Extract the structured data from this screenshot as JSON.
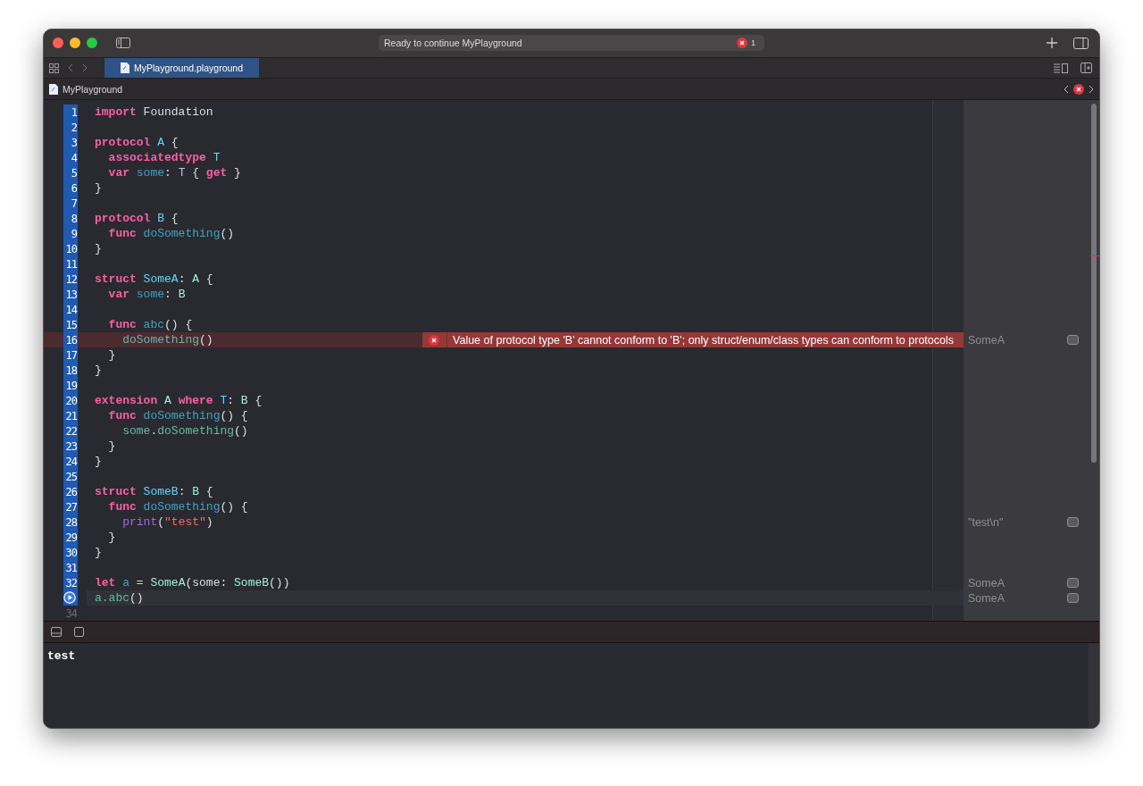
{
  "window": {
    "status": "Ready to continue MyPlayground",
    "error_count": "1"
  },
  "tabs": [
    {
      "label": "MyPlayground.playground",
      "selected": true
    }
  ],
  "jump_bar": {
    "label": "MyPlayground"
  },
  "editor": {
    "lines": [
      {
        "kind": "code",
        "number": "1",
        "executed": true,
        "tokens": [
          {
            "text": "import",
            "kind": "keyword"
          },
          {
            "text": " Foundation",
            "kind": "plain"
          }
        ]
      },
      {
        "kind": "code",
        "number": "2",
        "executed": true
      },
      {
        "kind": "code",
        "number": "3",
        "executed": true,
        "tokens": [
          {
            "text": "protocol",
            "kind": "keyword"
          },
          {
            "text": " A",
            "kind": "decl-type"
          },
          {
            "text": " {",
            "kind": "plain"
          }
        ]
      },
      {
        "kind": "code",
        "number": "4",
        "executed": true,
        "tokens": [
          {
            "text": "  associatedtype",
            "kind": "keyword"
          },
          {
            "text": " T",
            "kind": "decl-type"
          }
        ]
      },
      {
        "kind": "code",
        "number": "5",
        "executed": true,
        "tokens": [
          {
            "text": "  var",
            "kind": "keyword"
          },
          {
            "text": " some",
            "kind": "decl"
          },
          {
            "text": ": ",
            "kind": "plain"
          },
          {
            "text": "T",
            "kind": "generic"
          },
          {
            "text": " { ",
            "kind": "plain"
          },
          {
            "text": "get",
            "kind": "keyword"
          },
          {
            "text": " }",
            "kind": "plain"
          }
        ]
      },
      {
        "kind": "code",
        "number": "6",
        "executed": true,
        "tokens": [
          {
            "text": "}",
            "kind": "plain"
          }
        ]
      },
      {
        "kind": "code",
        "number": "7",
        "executed": true
      },
      {
        "kind": "code",
        "number": "8",
        "executed": true,
        "tokens": [
          {
            "text": "protocol",
            "kind": "keyword"
          },
          {
            "text": " B",
            "kind": "decl-type"
          },
          {
            "text": " {",
            "kind": "plain"
          }
        ]
      },
      {
        "kind": "code",
        "number": "9",
        "executed": true,
        "tokens": [
          {
            "text": "  func",
            "kind": "keyword"
          },
          {
            "text": " doSomething",
            "kind": "decl"
          },
          {
            "text": "()",
            "kind": "plain"
          }
        ]
      },
      {
        "kind": "code",
        "number": "10",
        "executed": true,
        "tokens": [
          {
            "text": "}",
            "kind": "plain"
          }
        ]
      },
      {
        "kind": "code",
        "number": "11",
        "executed": true
      },
      {
        "kind": "code",
        "number": "12",
        "executed": true,
        "tokens": [
          {
            "text": "struct",
            "kind": "keyword"
          },
          {
            "text": " SomeA",
            "kind": "decl-type"
          },
          {
            "text": ": ",
            "kind": "plain"
          },
          {
            "text": "A",
            "kind": "type"
          },
          {
            "text": " {",
            "kind": "plain"
          }
        ]
      },
      {
        "kind": "code",
        "number": "13",
        "executed": true,
        "tokens": [
          {
            "text": "  var",
            "kind": "keyword"
          },
          {
            "text": " some",
            "kind": "decl"
          },
          {
            "text": ": ",
            "kind": "plain"
          },
          {
            "text": "B",
            "kind": "type"
          }
        ]
      },
      {
        "kind": "code",
        "number": "14",
        "executed": true
      },
      {
        "kind": "code",
        "number": "15",
        "executed": true,
        "tokens": [
          {
            "text": "  func",
            "kind": "keyword"
          },
          {
            "text": " abc",
            "kind": "decl"
          },
          {
            "text": "() {",
            "kind": "plain"
          }
        ]
      },
      {
        "kind": "code",
        "number": "16",
        "executed": true,
        "tokens": [
          {
            "text": "    doSomething",
            "kind": "call"
          },
          {
            "text": "()",
            "kind": "plain"
          }
        ],
        "error": "Value of protocol type 'B' cannot conform to 'B'; only struct/enum/class types can conform to protocols",
        "result": "SomeA"
      },
      {
        "kind": "code",
        "number": "17",
        "executed": true,
        "tokens": [
          {
            "text": "  }",
            "kind": "plain"
          }
        ]
      },
      {
        "kind": "code",
        "number": "18",
        "executed": true,
        "tokens": [
          {
            "text": "}",
            "kind": "plain"
          }
        ]
      },
      {
        "kind": "code",
        "number": "19",
        "executed": true
      },
      {
        "kind": "code",
        "number": "20",
        "executed": true,
        "tokens": [
          {
            "text": "extension",
            "kind": "keyword"
          },
          {
            "text": " A",
            "kind": "type"
          },
          {
            "text": " where",
            "kind": "keyword"
          },
          {
            "text": " T",
            "kind": "decl-type"
          },
          {
            "text": ": ",
            "kind": "plain"
          },
          {
            "text": "B",
            "kind": "type"
          },
          {
            "text": " {",
            "kind": "plain"
          }
        ]
      },
      {
        "kind": "code",
        "number": "21",
        "executed": true,
        "tokens": [
          {
            "text": "  func",
            "kind": "keyword"
          },
          {
            "text": " doSomething",
            "kind": "decl"
          },
          {
            "text": "() {",
            "kind": "plain"
          }
        ]
      },
      {
        "kind": "code",
        "number": "22",
        "executed": true,
        "tokens": [
          {
            "text": "    some",
            "kind": "call"
          },
          {
            "text": ".",
            "kind": "plain"
          },
          {
            "text": "doSomething",
            "kind": "call"
          },
          {
            "text": "()",
            "kind": "plain"
          }
        ]
      },
      {
        "kind": "code",
        "number": "23",
        "executed": true,
        "tokens": [
          {
            "text": "  }",
            "kind": "plain"
          }
        ]
      },
      {
        "kind": "code",
        "number": "24",
        "executed": true,
        "tokens": [
          {
            "text": "}",
            "kind": "plain"
          }
        ]
      },
      {
        "kind": "code",
        "number": "25",
        "executed": true
      },
      {
        "kind": "code",
        "number": "26",
        "executed": true,
        "tokens": [
          {
            "text": "struct",
            "kind": "keyword"
          },
          {
            "text": " SomeB",
            "kind": "decl-type"
          },
          {
            "text": ": ",
            "kind": "plain"
          },
          {
            "text": "B",
            "kind": "type"
          },
          {
            "text": " {",
            "kind": "plain"
          }
        ]
      },
      {
        "kind": "code",
        "number": "27",
        "executed": true,
        "tokens": [
          {
            "text": "  func",
            "kind": "keyword"
          },
          {
            "text": " doSomething",
            "kind": "decl"
          },
          {
            "text": "() {",
            "kind": "plain"
          }
        ]
      },
      {
        "kind": "code",
        "number": "28",
        "executed": true,
        "tokens": [
          {
            "text": "    print",
            "kind": "builtin"
          },
          {
            "text": "(",
            "kind": "plain"
          },
          {
            "text": "\"test\"",
            "kind": "string"
          },
          {
            "text": ")",
            "kind": "plain"
          }
        ],
        "result": "\"test\\n\""
      },
      {
        "kind": "code",
        "number": "29",
        "executed": true,
        "tokens": [
          {
            "text": "  }",
            "kind": "plain"
          }
        ]
      },
      {
        "kind": "code",
        "number": "30",
        "executed": true,
        "tokens": [
          {
            "text": "}",
            "kind": "plain"
          }
        ]
      },
      {
        "kind": "code",
        "number": "31",
        "executed": true
      },
      {
        "kind": "code",
        "number": "32",
        "executed": true,
        "tokens": [
          {
            "text": "let",
            "kind": "keyword"
          },
          {
            "text": " a",
            "kind": "decl"
          },
          {
            "text": " = ",
            "kind": "plain"
          },
          {
            "text": "SomeA",
            "kind": "type"
          },
          {
            "text": "(some: ",
            "kind": "plain"
          },
          {
            "text": "SomeB",
            "kind": "type"
          },
          {
            "text": "())",
            "kind": "plain"
          }
        ],
        "result": "SomeA"
      },
      {
        "kind": "run-marker",
        "executed": true,
        "tokens": [
          {
            "text": "a.abc",
            "kind": "call"
          },
          {
            "text": "()",
            "kind": "plain"
          }
        ],
        "result": "SomeA"
      },
      {
        "kind": "code",
        "number": "34",
        "executed": false
      }
    ]
  },
  "console": {
    "output": "test"
  }
}
